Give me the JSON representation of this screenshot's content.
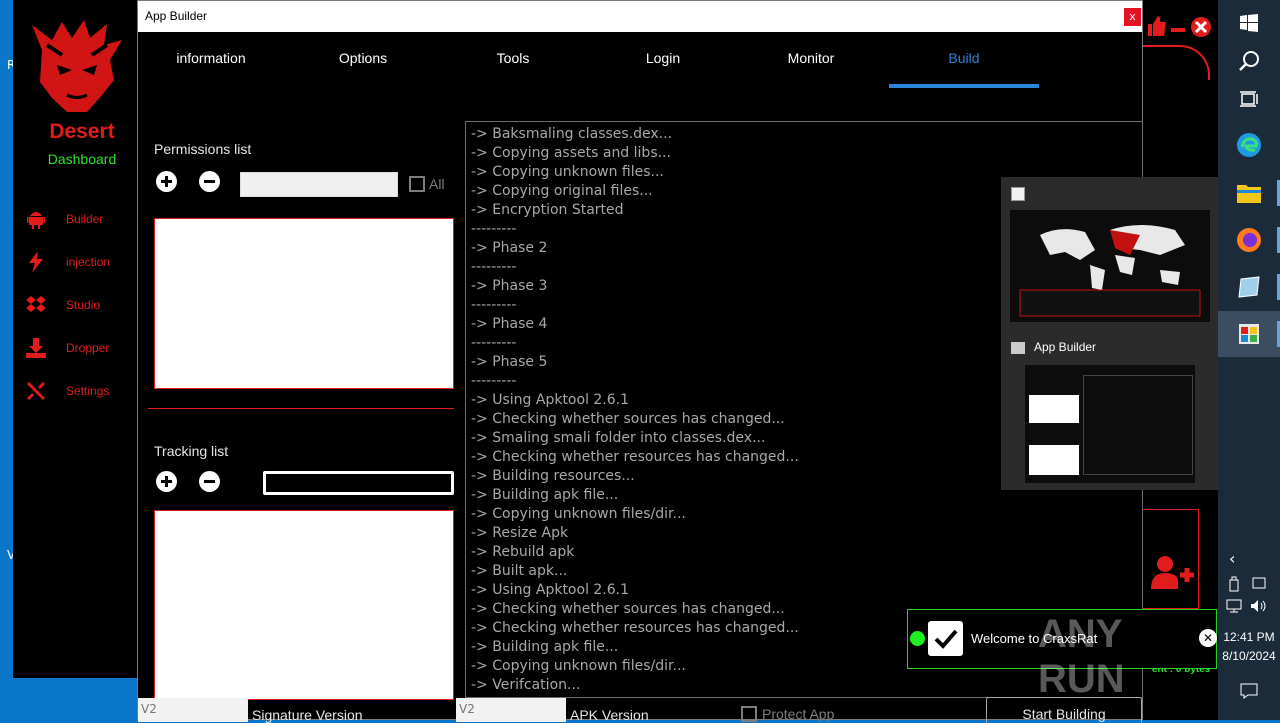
{
  "desktop": {
    "left_text_1": "R",
    "left_text_2": "V"
  },
  "dashboard": {
    "brand": "Desert",
    "subtitle": "Dashboard",
    "nav": [
      {
        "label": "Builder",
        "icon": "android-icon"
      },
      {
        "label": "injection",
        "icon": "lightning-icon"
      },
      {
        "label": "Studio",
        "icon": "dropbox-icon"
      },
      {
        "label": "Dropper",
        "icon": "download-icon"
      },
      {
        "label": "Settings",
        "icon": "tools-icon"
      }
    ],
    "status_text": "ent : 0 bytes"
  },
  "window": {
    "title": "App Builder",
    "close_label": "x",
    "tabs": [
      "information",
      "Options",
      "Tools",
      "Login",
      "Monitor",
      "Build"
    ],
    "active_tab": "Build"
  },
  "permissions": {
    "title": "Permissions list",
    "all_label": "All"
  },
  "tracking": {
    "title": "Tracking list"
  },
  "log": [
    "->  Baksmaling classes.dex...",
    "->  Copying assets and libs...",
    "->  Copying unknown files...",
    "->  Copying original files...",
    "-> Encryption Started",
    "---------",
    "-> Phase 2",
    "---------",
    "-> Phase 3",
    "---------",
    "-> Phase 4",
    "---------",
    "-> Phase 5",
    "---------",
    "->  Using Apktool 2.6.1",
    "->  Checking whether sources has changed...",
    "->  Smaling smali folder into classes.dex...",
    "->  Checking whether resources has changed...",
    "->  Building resources...",
    "->  Building apk file...",
    "->  Copying unknown files/dir...",
    "-> Resize Apk",
    "-> Rebuild apk",
    "->  Built apk...",
    "->  Using Apktool 2.6.1",
    "->  Checking whether sources has changed...",
    "->  Checking whether resources has changed...",
    "->  Building apk file...",
    "->  Copying unknown files/dir...",
    "->  Verifcation..."
  ],
  "footer": {
    "signature_value": "V2",
    "signature_label": "Signature Version",
    "apk_value": "V2",
    "apk_label": "APK Version",
    "protect_label": "Protect App",
    "start_label": "Start Building"
  },
  "taskbar_popup": {
    "window_title": "App Builder"
  },
  "notification": {
    "message": "Welcome to CraxsRat",
    "watermark": "ANY RUN"
  },
  "clock": {
    "time": "12:41 PM",
    "date": "8/10/2024"
  }
}
